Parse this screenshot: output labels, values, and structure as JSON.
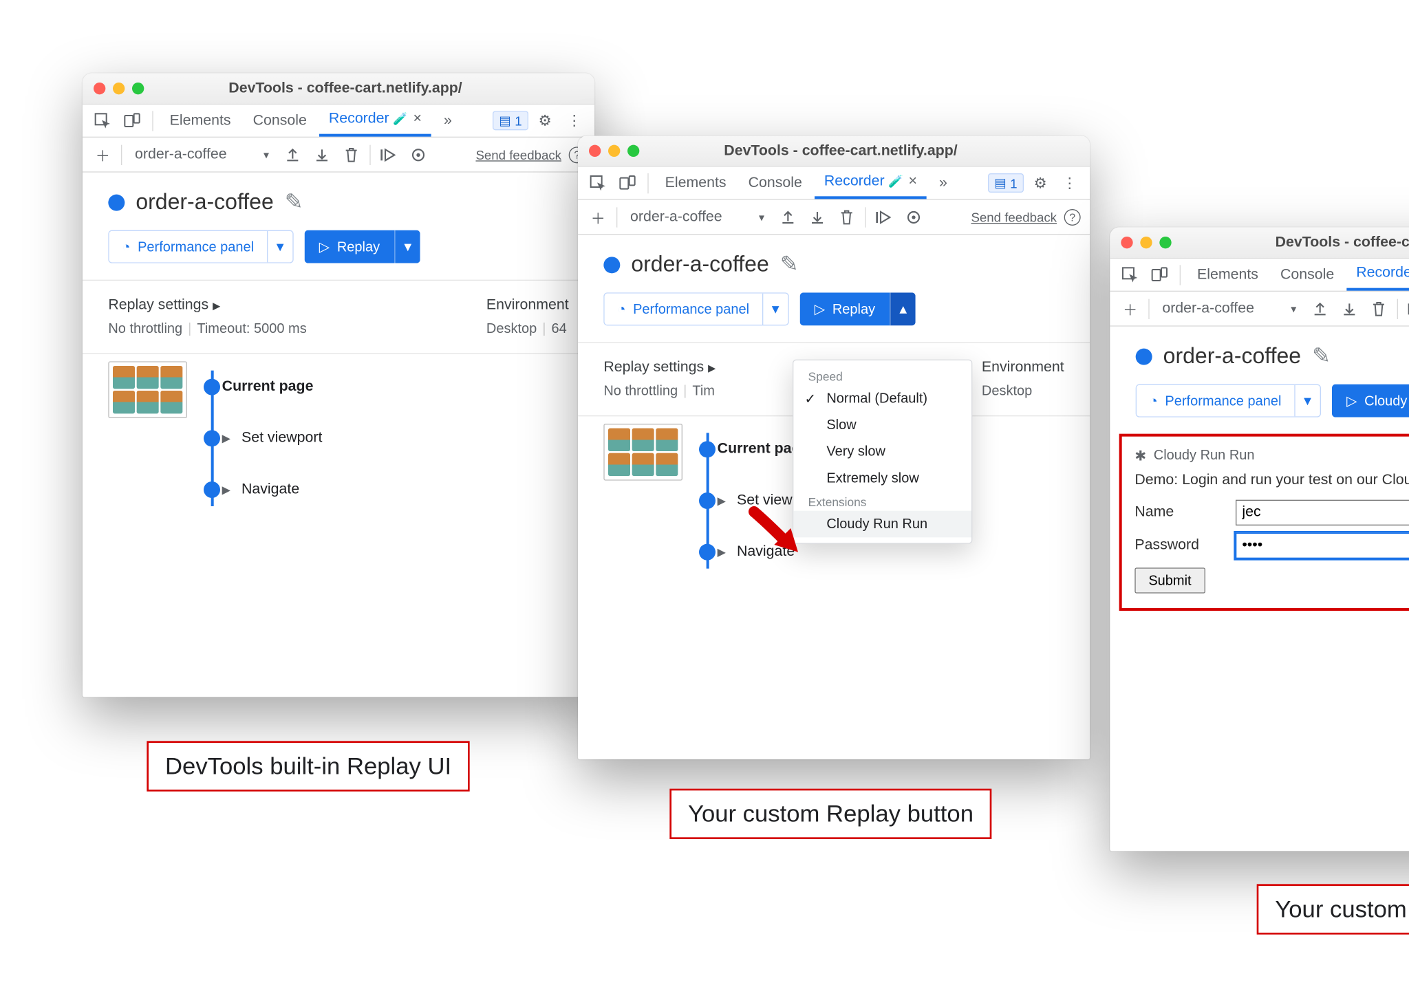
{
  "window_title": "DevTools - coffee-cart.netlify.app/",
  "tabs": {
    "elements": "Elements",
    "console": "Console",
    "recorder": "Recorder",
    "more": "»"
  },
  "issues_badge": "1",
  "toolbar": {
    "recording_name": "order-a-coffee",
    "feedback": "Send feedback"
  },
  "recording": {
    "title": "order-a-coffee",
    "perf_panel": "Performance panel",
    "replay": "Replay",
    "custom_replay": "Cloudy Run Run"
  },
  "settings": {
    "replay_header": "Replay settings",
    "throttling": "No throttling",
    "timeout": "Timeout: 5000 ms",
    "env_header": "Environment",
    "env_value": "Desktop",
    "env_value_ext": "64"
  },
  "steps": {
    "current": "Current page",
    "set_viewport": "Set viewport",
    "navigate": "Navigate"
  },
  "replay_menu": {
    "speed_hdr": "Speed",
    "normal": "Normal (Default)",
    "slow": "Slow",
    "very_slow": "Very slow",
    "extremely_slow": "Extremely slow",
    "ext_hdr": "Extensions",
    "cloudy": "Cloudy Run Run"
  },
  "ext_panel": {
    "title": "Cloudy Run Run",
    "desc": "Demo: Login and run your test on our Cloudy Run Run platform.",
    "name_label": "Name",
    "name_value": "jec",
    "pw_label": "Password",
    "pw_value": "••••",
    "submit": "Submit"
  },
  "captions": {
    "a": "DevTools built-in Replay UI",
    "b": "Your custom Replay button",
    "c": "Your custom Replay UI"
  }
}
